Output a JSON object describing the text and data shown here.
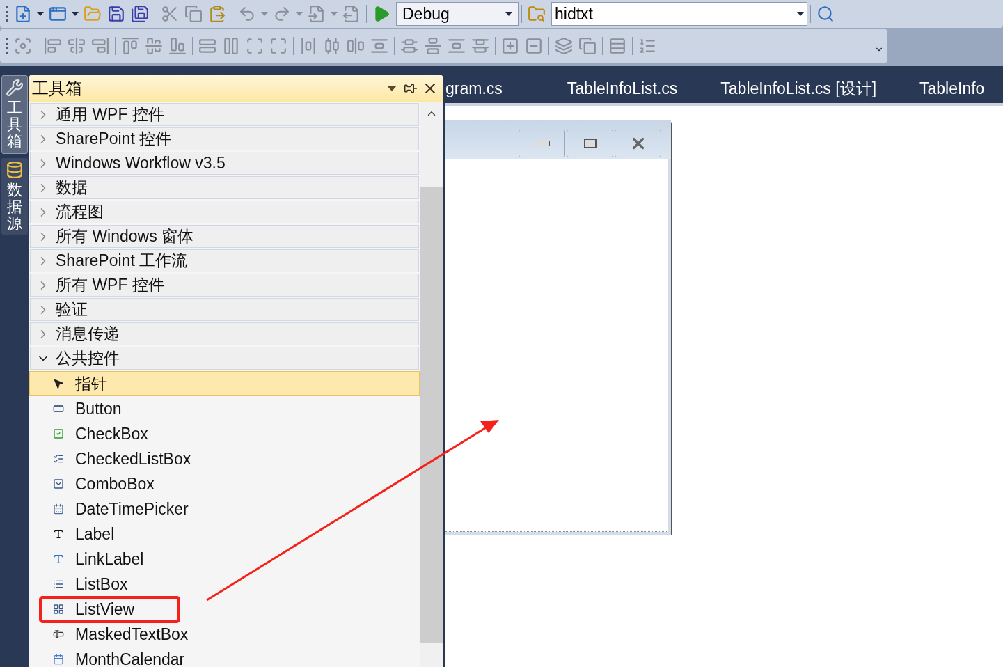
{
  "toolbar": {
    "configuration": "Debug",
    "find_box": "hidtxt"
  },
  "side_tabs": [
    {
      "label": "工具箱",
      "selected": true
    },
    {
      "label": "数据源",
      "selected": false
    }
  ],
  "toolbox": {
    "title": "工具箱",
    "categories": [
      {
        "label": "通用 WPF 控件",
        "expanded": false
      },
      {
        "label": "SharePoint 控件",
        "expanded": false
      },
      {
        "label": "Windows Workflow v3.5",
        "expanded": false
      },
      {
        "label": "数据",
        "expanded": false
      },
      {
        "label": "流程图",
        "expanded": false
      },
      {
        "label": "所有 Windows 窗体",
        "expanded": false
      },
      {
        "label": "SharePoint 工作流",
        "expanded": false
      },
      {
        "label": "所有 WPF 控件",
        "expanded": false
      },
      {
        "label": "验证",
        "expanded": false
      },
      {
        "label": "消息传递",
        "expanded": false
      },
      {
        "label": "公共控件",
        "expanded": true,
        "children": [
          {
            "label": "指针",
            "selected": true
          },
          {
            "label": "Button",
            "selected": false
          },
          {
            "label": "CheckBox",
            "selected": false
          },
          {
            "label": "CheckedListBox",
            "selected": false
          },
          {
            "label": "ComboBox",
            "selected": false
          },
          {
            "label": "DateTimePicker",
            "selected": false
          },
          {
            "label": "Label",
            "selected": false
          },
          {
            "label": "LinkLabel",
            "selected": false
          },
          {
            "label": "ListBox",
            "selected": false
          },
          {
            "label": "ListView",
            "selected": false
          },
          {
            "label": "MaskedTextBox",
            "selected": false
          },
          {
            "label": "MonthCalendar",
            "selected": false
          }
        ]
      }
    ]
  },
  "document_tabs": [
    {
      "label": "gram.cs",
      "selected": false
    },
    {
      "label": "TableInfoList.cs",
      "selected": false
    },
    {
      "label": "TableInfoList.cs [设计]",
      "selected": false
    },
    {
      "label": "TableInfo",
      "selected": false
    }
  ]
}
